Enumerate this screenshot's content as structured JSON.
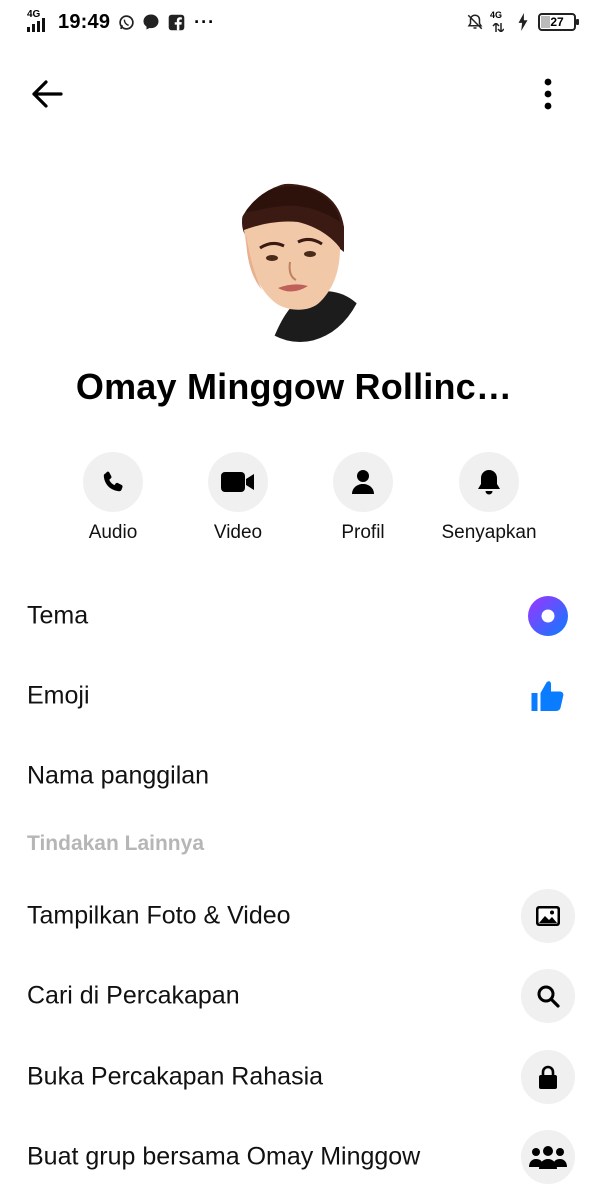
{
  "status_bar": {
    "network_left": "4G",
    "time": "19:49",
    "network_right": "4G",
    "battery": "27",
    "overflow": "···",
    "icons": [
      "whatsapp-icon",
      "messenger-icon",
      "facebook-icon",
      "bell-off-icon",
      "charging-icon"
    ]
  },
  "header": {
    "back_icon": "arrow-left-icon",
    "menu_icon": "more-vertical-icon"
  },
  "profile": {
    "name": "Omay Minggow Rollinc…"
  },
  "actions": [
    {
      "label": "Audio",
      "icon": "phone-icon"
    },
    {
      "label": "Video",
      "icon": "video-camera-icon"
    },
    {
      "label": "Profil",
      "icon": "person-icon"
    },
    {
      "label": "Senyapkan",
      "icon": "bell-icon"
    }
  ],
  "settings": [
    {
      "label": "Tema",
      "icon": "theme-gradient-icon"
    },
    {
      "label": "Emoji",
      "icon": "thumbs-up-icon"
    },
    {
      "label": "Nama panggilan"
    }
  ],
  "more_actions": {
    "title": "Tindakan Lainnya",
    "items": [
      {
        "label": "Tampilkan Foto & Video",
        "icon": "image-icon"
      },
      {
        "label": "Cari di Percakapan",
        "icon": "search-icon"
      },
      {
        "label": "Buka Percakapan Rahasia",
        "icon": "lock-icon"
      },
      {
        "label": "Buat grup bersama Omay Minggow",
        "icon": "group-icon"
      }
    ]
  },
  "colors": {
    "accent_blue": "#0a7cff",
    "theme_gradient_start": "#a033ff",
    "theme_gradient_end": "#0a7cff",
    "button_bg": "#f0f0f0",
    "section_title": "#b6b6b6"
  }
}
